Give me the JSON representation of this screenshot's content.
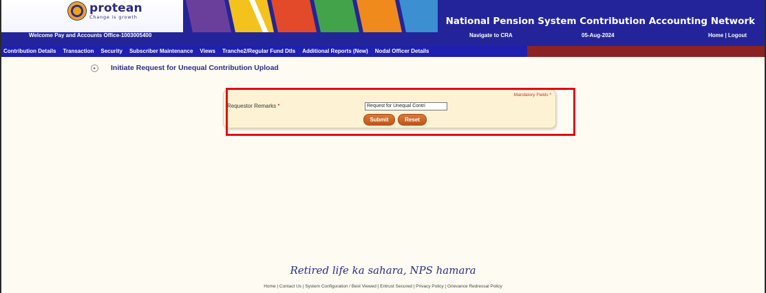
{
  "header": {
    "logo_name": "protean",
    "logo_tagline": "Change is growth",
    "site_title": "National Pension System Contribution Accounting Network",
    "stripe_colors": [
      "#6a3f9b",
      "#f3c21c",
      "#e24a2a",
      "#43a34a",
      "#f08a1c",
      "#3c8fd0"
    ]
  },
  "welcome_bar": {
    "welcome": "Welcome Pay and Accounts Office-1003005400",
    "navigate": "Navigate to CRA",
    "date": "05-Aug-2024",
    "home_logout": "Home | Logout"
  },
  "menu": {
    "items": [
      "Contribution Details",
      "Transaction",
      "Security",
      "Subscriber Maintenance",
      "Views",
      "Tranche2/Regular Fund Dtls",
      "Additional Reports (New)",
      "Nodal Officer Details"
    ]
  },
  "page": {
    "title": "Initiate Request for Unequal Contribution Upload"
  },
  "form": {
    "mandatory": "Mandatory Fields",
    "star": "*",
    "label": "Requestor Remarks",
    "input_value": "Request for Unequal Contri",
    "submit": "Submit",
    "reset": "Reset"
  },
  "tagline": "Retired life ka sahara, NPS hamara",
  "footer": {
    "links": [
      "Home",
      "Contact Us",
      "System Configuration / Best Viewed",
      "Entrust Secured",
      "Privacy Policy",
      "Grievance Redressal Policy"
    ],
    "separator": " | "
  },
  "colors": {
    "header_blue": "#24249a",
    "menu_blue": "#1f1fb0",
    "menu_maroon": "#8b2323",
    "button_orange": "#c0561a",
    "highlight_red": "#e30613"
  }
}
